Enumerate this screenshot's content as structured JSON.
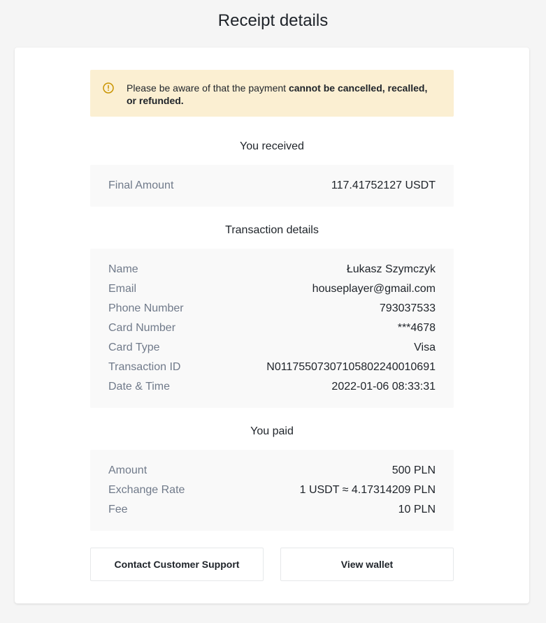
{
  "page": {
    "title": "Receipt details"
  },
  "warning": {
    "icon": "warning-icon",
    "text_prefix": "Please be aware of that the payment ",
    "text_bold": "cannot be cancelled, recalled, or refunded."
  },
  "received": {
    "title": "You received",
    "rows": [
      {
        "label": "Final Amount",
        "value": "117.41752127 USDT"
      }
    ]
  },
  "transaction": {
    "title": "Transaction details",
    "rows": [
      {
        "label": "Name",
        "value": "Łukasz Szymczyk"
      },
      {
        "label": "Email",
        "value": "houseplayer@gmail.com"
      },
      {
        "label": "Phone Number",
        "value": "793037533"
      },
      {
        "label": "Card Number",
        "value": "***4678"
      },
      {
        "label": "Card Type",
        "value": "Visa"
      },
      {
        "label": "Transaction ID",
        "value": "N01175507307105802240010691"
      },
      {
        "label": "Date & Time",
        "value": "2022-01-06 08:33:31"
      }
    ]
  },
  "paid": {
    "title": "You paid",
    "rows": [
      {
        "label": "Amount",
        "value": "500 PLN"
      },
      {
        "label": "Exchange Rate",
        "value": "1 USDT ≈ 4.17314209 PLN"
      },
      {
        "label": "Fee",
        "value": "10 PLN"
      }
    ]
  },
  "buttons": {
    "support": "Contact Customer Support",
    "wallet": "View wallet"
  },
  "colors": {
    "warning_bg": "#fbefd2",
    "warning_icon": "#c99400",
    "label_gray": "#707a8a",
    "text_dark": "#1e2329"
  }
}
